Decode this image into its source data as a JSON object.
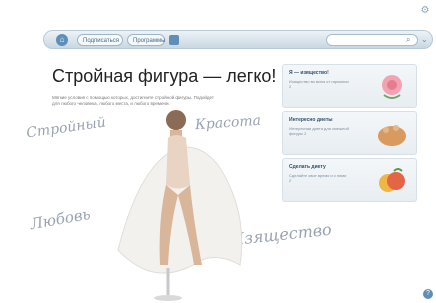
{
  "top_icon": "⚙",
  "nav": {
    "home_icon": "home-icon",
    "buttons": [
      "Подписаться",
      "Программы"
    ],
    "search_placeholder": ""
  },
  "hero": {
    "title": "Стройная фигура — легко!",
    "intro": "Мягкие условия с помощью которых, достигните стройной фигуры. Подойдет для любого человека, любого места, и любого времени."
  },
  "script_words": [
    "Стройный",
    "Красота",
    "Любовь",
    "Изящество"
  ],
  "cards": [
    {
      "title": "Я — изящество!",
      "text": "Изящество во всем от гармонии 2"
    },
    {
      "title": "Интересно диеты",
      "text": "Интересная диета для смешной фигуры 2"
    },
    {
      "title": "Сделать диету",
      "text": "Сделайте свое время и с ними 2"
    }
  ],
  "colors": {
    "accent": "#5f8fb6",
    "text": "#222222"
  }
}
